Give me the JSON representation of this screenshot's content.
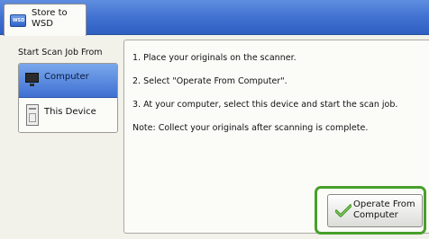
{
  "tab": {
    "title": "Store to WSD",
    "icon": "wsd-icon",
    "icon_text": "WSD"
  },
  "left_panel": {
    "title": "Start Scan Job From",
    "items": [
      {
        "label": "Computer",
        "icon": "computer-icon",
        "selected": true
      },
      {
        "label": "This Device",
        "icon": "device-icon",
        "selected": false
      }
    ]
  },
  "instructions": [
    "1. Place your originals on the scanner.",
    "2. Select \"Operate From Computer\".",
    "3. At your computer, select this device and start the scan job.",
    "Note: Collect your originals after scanning is complete."
  ],
  "operate_button": {
    "label": "Operate From\nComputer",
    "icon": "checkmark-icon"
  },
  "colors": {
    "header_blue": "#3f6fd0",
    "selection_blue": "#3f70d2",
    "highlight_green": "#47a02a"
  }
}
